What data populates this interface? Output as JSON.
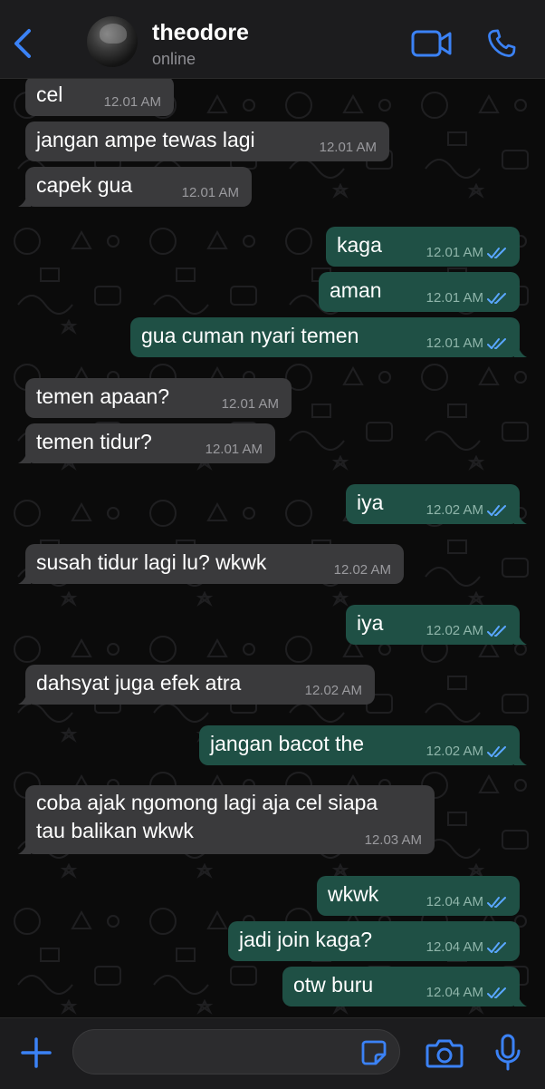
{
  "header": {
    "contact_name": "theodore",
    "status": "online",
    "icons": [
      "back-chevron-icon",
      "avatar",
      "video-camera-icon",
      "phone-icon"
    ],
    "accent_color": "#3b82f6"
  },
  "messages": [
    {
      "dir": "in",
      "text": "cel",
      "time": "12.01 AM"
    },
    {
      "dir": "in",
      "text": "jangan ampe tewas lagi",
      "time": "12.01 AM"
    },
    {
      "dir": "in",
      "text": "capek gua",
      "time": "12.01 AM"
    },
    {
      "dir": "out",
      "text": "kaga",
      "time": "12.01 AM",
      "read": true
    },
    {
      "dir": "out",
      "text": "aman",
      "time": "12.01 AM",
      "read": true
    },
    {
      "dir": "out",
      "text": "gua cuman nyari temen",
      "time": "12.01 AM",
      "read": true
    },
    {
      "dir": "in",
      "text": "temen apaan?",
      "time": "12.01 AM"
    },
    {
      "dir": "in",
      "text": "temen tidur?",
      "time": "12.01 AM"
    },
    {
      "dir": "out",
      "text": "iya",
      "time": "12.02 AM",
      "read": true
    },
    {
      "dir": "in",
      "text": "susah tidur lagi lu? wkwk",
      "time": "12.02 AM"
    },
    {
      "dir": "out",
      "text": "iya",
      "time": "12.02 AM",
      "read": true
    },
    {
      "dir": "in",
      "text": "dahsyat juga efek atra",
      "time": "12.02 AM"
    },
    {
      "dir": "out",
      "text": "jangan bacot the",
      "time": "12.02 AM",
      "read": true
    },
    {
      "dir": "in",
      "text": "coba ajak ngomong lagi aja cel siapa\ntau balikan wkwk",
      "time": "12.03 AM"
    },
    {
      "dir": "out",
      "text": "wkwk",
      "time": "12.04 AM",
      "read": true
    },
    {
      "dir": "out",
      "text": "jadi join kaga?",
      "time": "12.04 AM",
      "read": true
    },
    {
      "dir": "out",
      "text": "otw buru",
      "time": "12.04 AM",
      "read": true
    }
  ],
  "composer": {
    "placeholder": "",
    "icons": [
      "plus-icon",
      "sticker-icon",
      "camera-icon",
      "microphone-icon"
    ]
  },
  "colors": {
    "incoming_bubble": "#3a3a3c",
    "outgoing_bubble": "#1f5045",
    "read_ticks": "#5aa7ff",
    "background": "#0b0b0b"
  }
}
